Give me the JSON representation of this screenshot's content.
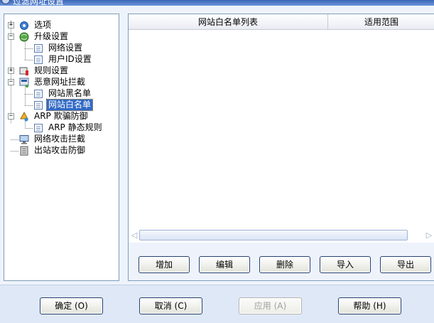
{
  "window": {
    "title": "过滤网址设置"
  },
  "tree": {
    "items": [
      {
        "label": "选项",
        "icon": "gear-icon"
      },
      {
        "label": "升级设置",
        "icon": "globe-icon"
      },
      {
        "label": "网络设置",
        "icon": "page-icon"
      },
      {
        "label": "用户ID设置",
        "icon": "page-icon"
      },
      {
        "label": "规则设置",
        "icon": "rules-icon"
      },
      {
        "label": "恶意网址拦截",
        "icon": "blocker-icon"
      },
      {
        "label": "网站黑名单",
        "icon": "page-icon"
      },
      {
        "label": "网站白名单",
        "icon": "page-icon",
        "selected": true
      },
      {
        "label": "ARP 欺骗防御",
        "icon": "arp-icon"
      },
      {
        "label": "ARP 静态规则",
        "icon": "page-icon"
      },
      {
        "label": "网络攻击拦截",
        "icon": "monitor-icon"
      },
      {
        "label": "出站攻击防御",
        "icon": "server-icon"
      }
    ]
  },
  "list": {
    "columns": [
      "网站白名单列表",
      "适用范围"
    ],
    "rows": []
  },
  "list_buttons": {
    "add": "增加",
    "edit": "编辑",
    "delete": "删除",
    "import": "导入",
    "export": "导出"
  },
  "dialog_buttons": {
    "ok": "确定 (O)",
    "cancel": "取消 (C)",
    "apply": "应用 (A)",
    "help": "帮助 (H)"
  },
  "colors": {
    "accent": "#316ac5",
    "border": "#7f9db9",
    "button_border": "#27406f"
  }
}
